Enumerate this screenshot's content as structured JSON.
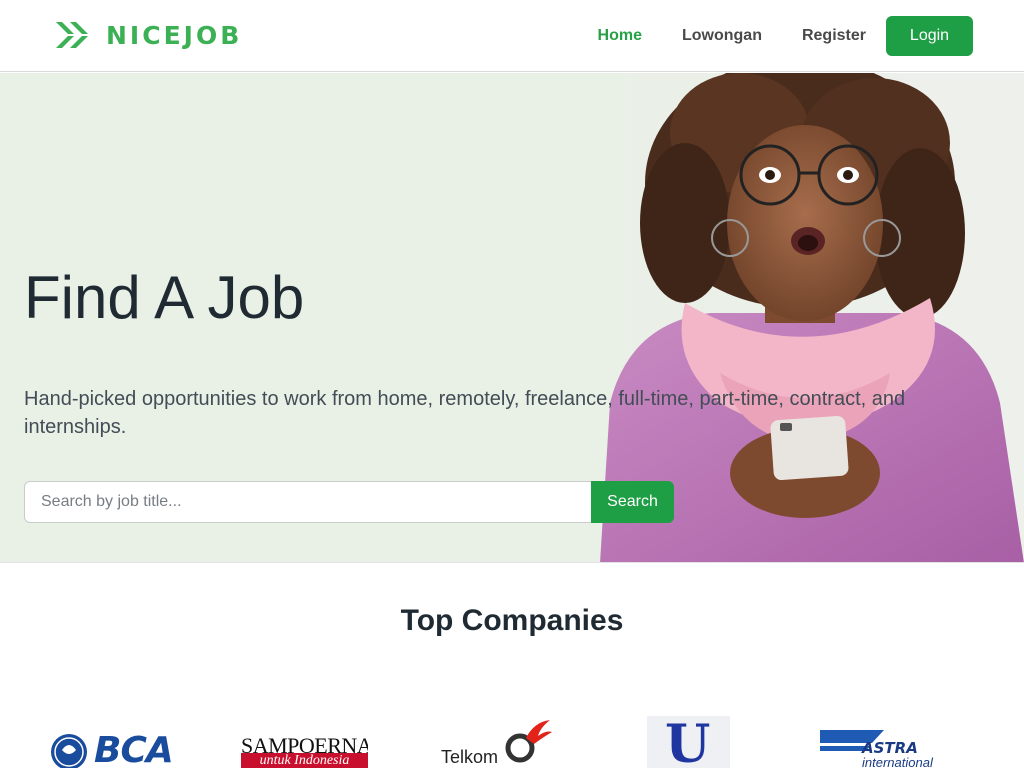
{
  "brand": {
    "name": "NICEJOB",
    "logo_icon": "nicejob-x-icon"
  },
  "nav": {
    "items": [
      {
        "label": "Home",
        "active": true
      },
      {
        "label": "Lowongan",
        "active": false
      },
      {
        "label": "Register",
        "active": false
      }
    ],
    "login_label": "Login"
  },
  "hero": {
    "title": "Find A Job",
    "subtitle": "Hand-picked opportunities to work from home, remotely, freelance, full-time, part-time, contract, and internships.",
    "search_placeholder": "Search by job title...",
    "search_label": "Search"
  },
  "companies": {
    "title": "Top Companies",
    "logos": [
      {
        "name": "BCA",
        "text": "BCA"
      },
      {
        "name": "Sampoerna",
        "text": "SAMPOERNA",
        "tagline": "untuk Indonesia"
      },
      {
        "name": "Telkom",
        "text": "Telkom"
      },
      {
        "name": "Unilever",
        "text": "U"
      },
      {
        "name": "Astra",
        "text": "ASTRA",
        "tagline": "international"
      }
    ]
  },
  "colors": {
    "brand_green": "#3bb054",
    "button_green": "#1e9e45",
    "hero_bg": "#e9f1e7"
  }
}
